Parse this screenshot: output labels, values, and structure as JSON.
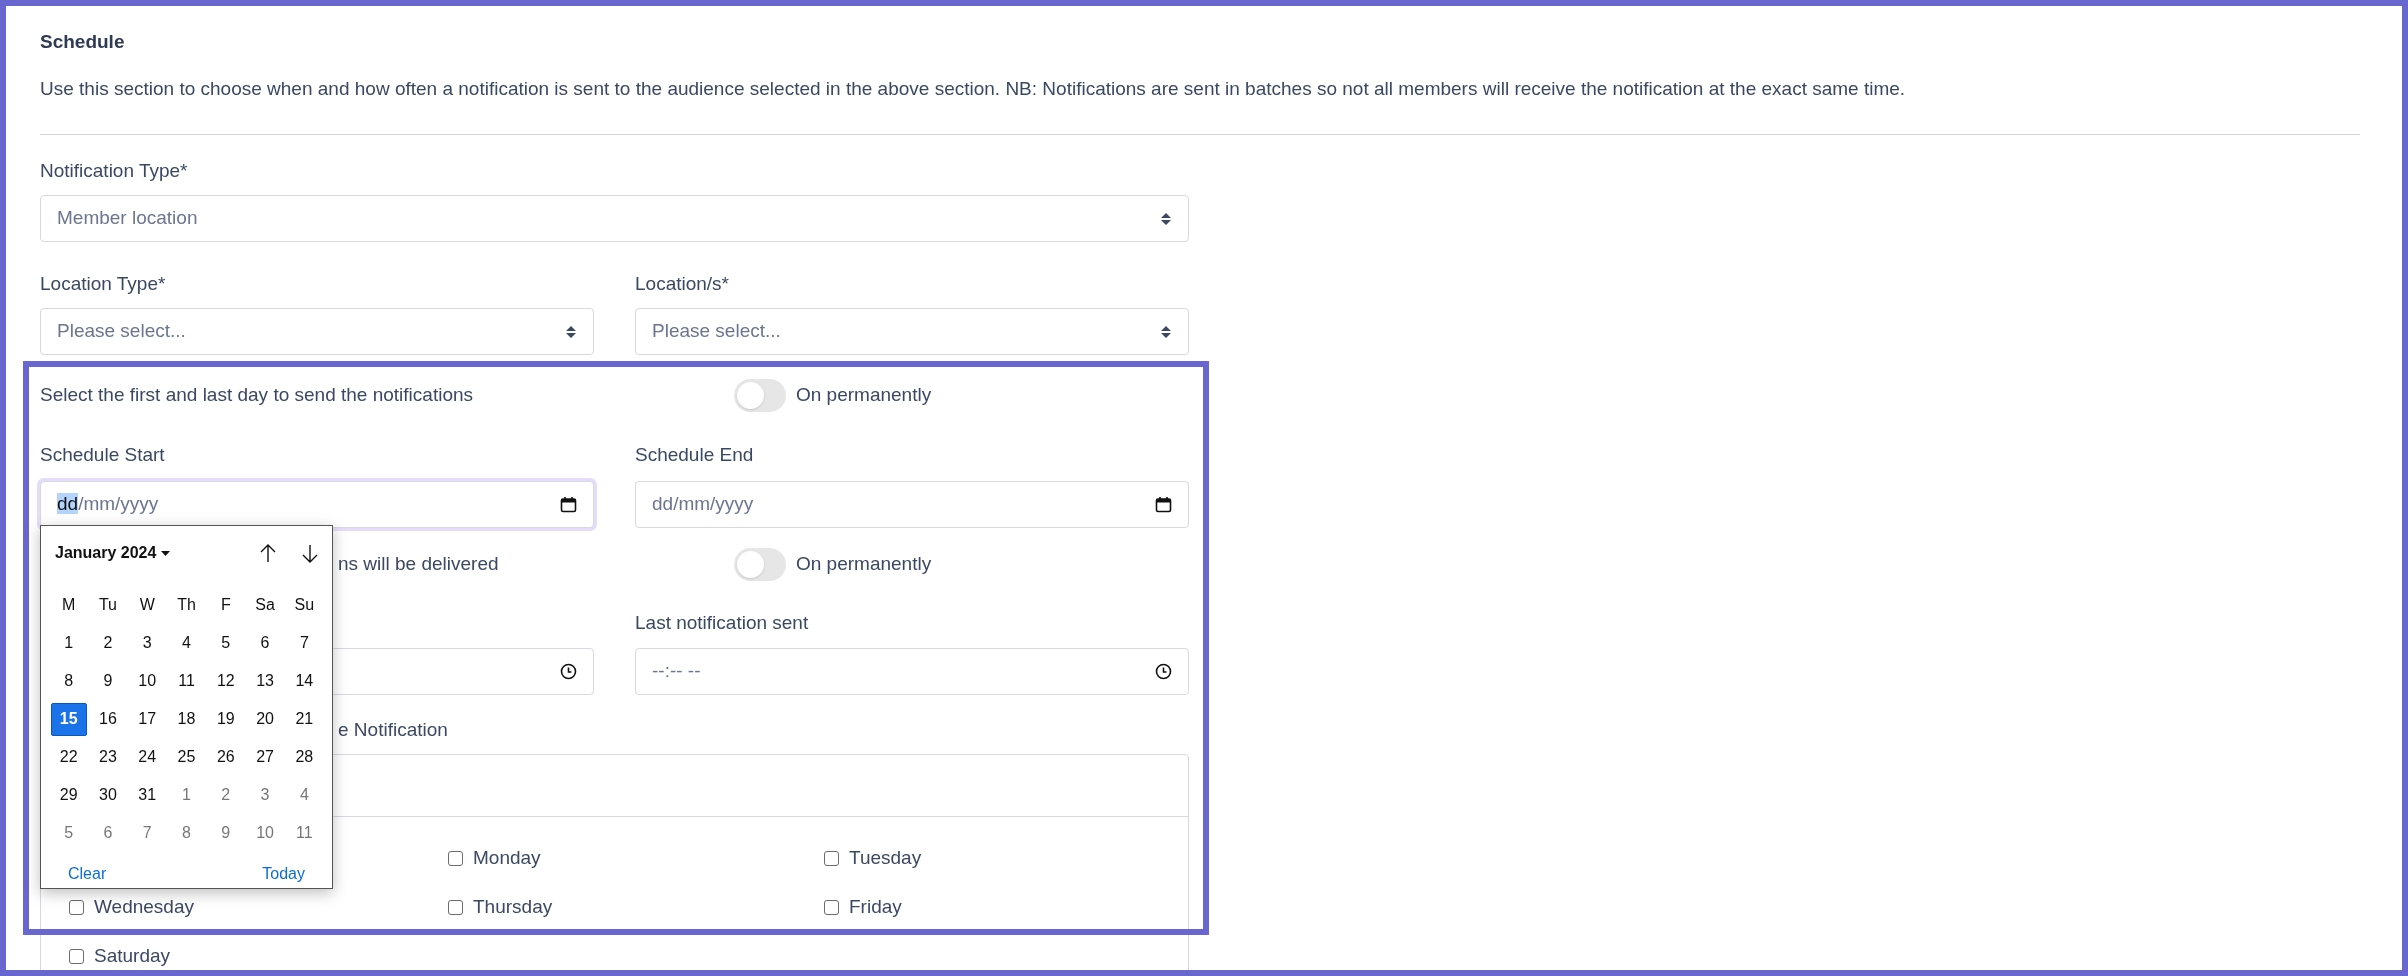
{
  "section": {
    "title": "Schedule",
    "description": "Use this section to choose when and how often a notification is sent to the audience selected in the above section. NB: Notifications are sent in batches so not all members will receive the notification at the exact same time."
  },
  "notification_type": {
    "label": "Notification Type*",
    "value": "Member location"
  },
  "location_type": {
    "label": "Location Type*",
    "placeholder": "Please select..."
  },
  "locations": {
    "label": "Location/s*",
    "placeholder": "Please select..."
  },
  "date_range": {
    "text": "Select the first and last day to send the notifications",
    "toggle": {
      "label": "On permanently",
      "on": false
    }
  },
  "schedule_start": {
    "label": "Schedule Start",
    "focused": true,
    "parts": [
      {
        "text": "dd",
        "selected": true
      },
      {
        "text": "/mm/yyyy",
        "selected": false
      }
    ]
  },
  "schedule_end": {
    "label": "Schedule End",
    "focused": false,
    "parts": [
      {
        "text": "dd/mm/yyyy",
        "selected": false
      }
    ]
  },
  "time_range": {
    "text": "ns will be delivered",
    "toggle": {
      "label": "On permanently",
      "on": false
    }
  },
  "last_time": {
    "label": "Last notification sent",
    "value": "--:-- --"
  },
  "days_label": "e Notification",
  "days": [
    {
      "label": "Monday",
      "checked": false
    },
    {
      "label": "Tuesday",
      "checked": false
    },
    {
      "label": "Wednesday",
      "checked": false
    },
    {
      "label": "Thursday",
      "checked": false
    },
    {
      "label": "Friday",
      "checked": false
    },
    {
      "label": "Saturday",
      "checked": false
    }
  ],
  "calendar": {
    "month": "January 2024",
    "weekdays": [
      "M",
      "Tu",
      "W",
      "Th",
      "F",
      "Sa",
      "Su"
    ],
    "weeks": [
      [
        {
          "day": "1",
          "muted": false,
          "selected": false
        },
        {
          "day": "2",
          "muted": false,
          "selected": false
        },
        {
          "day": "3",
          "muted": false,
          "selected": false
        },
        {
          "day": "4",
          "muted": false,
          "selected": false
        },
        {
          "day": "5",
          "muted": false,
          "selected": false
        },
        {
          "day": "6",
          "muted": false,
          "selected": false
        },
        {
          "day": "7",
          "muted": false,
          "selected": false
        }
      ],
      [
        {
          "day": "8",
          "muted": false,
          "selected": false
        },
        {
          "day": "9",
          "muted": false,
          "selected": false
        },
        {
          "day": "10",
          "muted": false,
          "selected": false
        },
        {
          "day": "11",
          "muted": false,
          "selected": false
        },
        {
          "day": "12",
          "muted": false,
          "selected": false
        },
        {
          "day": "13",
          "muted": false,
          "selected": false
        },
        {
          "day": "14",
          "muted": false,
          "selected": false
        }
      ],
      [
        {
          "day": "15",
          "muted": false,
          "selected": true
        },
        {
          "day": "16",
          "muted": false,
          "selected": false
        },
        {
          "day": "17",
          "muted": false,
          "selected": false
        },
        {
          "day": "18",
          "muted": false,
          "selected": false
        },
        {
          "day": "19",
          "muted": false,
          "selected": false
        },
        {
          "day": "20",
          "muted": false,
          "selected": false
        },
        {
          "day": "21",
          "muted": false,
          "selected": false
        }
      ],
      [
        {
          "day": "22",
          "muted": false,
          "selected": false
        },
        {
          "day": "23",
          "muted": false,
          "selected": false
        },
        {
          "day": "24",
          "muted": false,
          "selected": false
        },
        {
          "day": "25",
          "muted": false,
          "selected": false
        },
        {
          "day": "26",
          "muted": false,
          "selected": false
        },
        {
          "day": "27",
          "muted": false,
          "selected": false
        },
        {
          "day": "28",
          "muted": false,
          "selected": false
        }
      ],
      [
        {
          "day": "29",
          "muted": false,
          "selected": false
        },
        {
          "day": "30",
          "muted": false,
          "selected": false
        },
        {
          "day": "31",
          "muted": false,
          "selected": false
        },
        {
          "day": "1",
          "muted": true,
          "selected": false
        },
        {
          "day": "2",
          "muted": true,
          "selected": false
        },
        {
          "day": "3",
          "muted": true,
          "selected": false
        },
        {
          "day": "4",
          "muted": true,
          "selected": false
        }
      ],
      [
        {
          "day": "5",
          "muted": true,
          "selected": false
        },
        {
          "day": "6",
          "muted": true,
          "selected": false
        },
        {
          "day": "7",
          "muted": true,
          "selected": false
        },
        {
          "day": "8",
          "muted": true,
          "selected": false
        },
        {
          "day": "9",
          "muted": true,
          "selected": false
        },
        {
          "day": "10",
          "muted": true,
          "selected": false
        },
        {
          "day": "11",
          "muted": true,
          "selected": false
        }
      ]
    ],
    "clear": "Clear",
    "today": "Today"
  }
}
